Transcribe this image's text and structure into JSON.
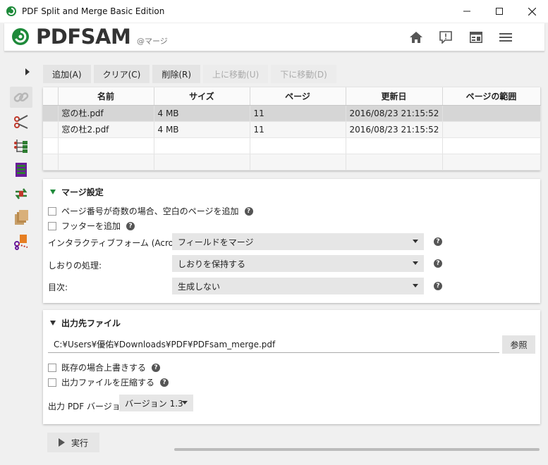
{
  "window": {
    "title": "PDF Split and Merge Basic Edition"
  },
  "header": {
    "logo_text": "PDFSAM",
    "module_label": "@マージ",
    "icons": [
      "home-icon",
      "feedback-icon",
      "news-icon",
      "menu-icon"
    ]
  },
  "sidebar": {
    "tools": [
      {
        "name": "merge",
        "active": true
      },
      {
        "name": "split"
      },
      {
        "name": "split-by-bookmarks"
      },
      {
        "name": "alternate-mix"
      },
      {
        "name": "rotate"
      },
      {
        "name": "extract"
      },
      {
        "name": "split-by-size"
      }
    ]
  },
  "toolbar": {
    "add": "追加(A)",
    "clear": "クリア(C)",
    "remove": "削除(R)",
    "move_up": "上に移動(U)",
    "move_down": "下に移動(D)"
  },
  "table": {
    "columns": [
      "名前",
      "サイズ",
      "ページ",
      "更新日",
      "ページの範囲"
    ],
    "rows": [
      {
        "name": "窓の杜.pdf",
        "size": "4 MB",
        "pages": "11",
        "modified": "2016/08/23 21:15:52",
        "range": ""
      },
      {
        "name": "窓の杜2.pdf",
        "size": "4 MB",
        "pages": "11",
        "modified": "2016/08/23 21:15:52",
        "range": ""
      }
    ]
  },
  "merge_settings": {
    "title": "マージ設定",
    "blank_page_label": "ページ番号が奇数の場合、空白のページを追加",
    "footer_label": "フッターを追加",
    "acroforms_label": "インタラクティブフォーム (AcroForms):",
    "acroforms_value": "フィールドをマージ",
    "bookmarks_label": "しおりの処理:",
    "bookmarks_value": "しおりを保持する",
    "toc_label": "目次:",
    "toc_value": "生成しない"
  },
  "output": {
    "title": "出力先ファイル",
    "path": "C:¥Users¥優佑¥Downloads¥PDF¥PDFsam_merge.pdf",
    "browse": "参照",
    "overwrite_label": "既存の場合上書きする",
    "compress_label": "出力ファイルを圧縮する",
    "version_label": "出力 PDF バージョン:",
    "version_value": "バージョン 1.3"
  },
  "run": {
    "label": "実行",
    "progress": 0
  },
  "colors": {
    "accent": "#1e8a3a",
    "selected_row": "#d6d6d6"
  }
}
